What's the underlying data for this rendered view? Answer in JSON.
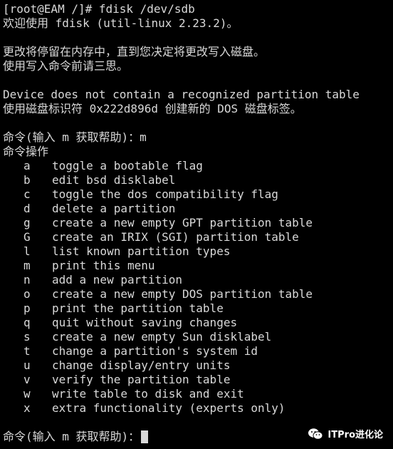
{
  "terminal": {
    "command_line": "[root@EAM /]# fdisk /dev/sdb",
    "welcome": "欢迎使用 fdisk (util-linux 2.23.2)。",
    "notice_1": "更改将停留在内存中，直到您决定将更改写入磁盘。",
    "notice_2": "使用写入命令前请三思。",
    "device_msg": "Device does not contain a recognized partition table",
    "label_msg": "使用磁盘标识符 0x222d896d 创建新的 DOS 磁盘标签。",
    "help_prompt": "命令(输入 m 获取帮助)：m",
    "menu_title": "命令操作",
    "menu": [
      {
        "key": "a",
        "desc": "toggle a bootable flag"
      },
      {
        "key": "b",
        "desc": "edit bsd disklabel"
      },
      {
        "key": "c",
        "desc": "toggle the dos compatibility flag"
      },
      {
        "key": "d",
        "desc": "delete a partition"
      },
      {
        "key": "g",
        "desc": "create a new empty GPT partition table"
      },
      {
        "key": "G",
        "desc": "create an IRIX (SGI) partition table"
      },
      {
        "key": "l",
        "desc": "list known partition types"
      },
      {
        "key": "m",
        "desc": "print this menu"
      },
      {
        "key": "n",
        "desc": "add a new partition"
      },
      {
        "key": "o",
        "desc": "create a new empty DOS partition table"
      },
      {
        "key": "p",
        "desc": "print the partition table"
      },
      {
        "key": "q",
        "desc": "quit without saving changes"
      },
      {
        "key": "s",
        "desc": "create a new empty Sun disklabel"
      },
      {
        "key": "t",
        "desc": "change a partition's system id"
      },
      {
        "key": "u",
        "desc": "change display/entry units"
      },
      {
        "key": "v",
        "desc": "verify the partition table"
      },
      {
        "key": "w",
        "desc": "write table to disk and exit"
      },
      {
        "key": "x",
        "desc": "extra functionality (experts only)"
      }
    ],
    "final_prompt": "命令(输入 m 获取帮助)："
  },
  "watermark": {
    "text": "ITPro进化论",
    "icon": "wechat-icon"
  }
}
